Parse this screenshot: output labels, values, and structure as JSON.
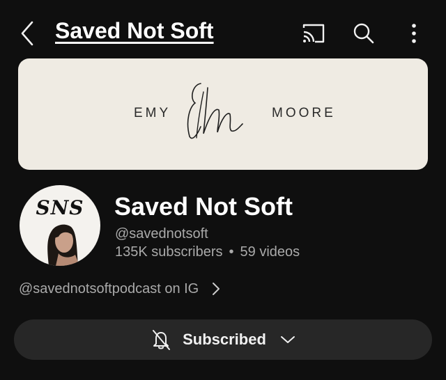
{
  "app_bar": {
    "title": "Saved Not Soft",
    "icons": {
      "back": "back-arrow-icon",
      "cast": "cast-icon",
      "search": "search-icon",
      "more": "more-vert-icon"
    }
  },
  "banner": {
    "left_text": "EMY",
    "right_text": "MOORE",
    "background": "#efebe3"
  },
  "channel": {
    "avatar_text": "SNS",
    "name": "Saved Not Soft",
    "handle": "@savednotsoft",
    "subscribers": "135K subscribers",
    "separator": "•",
    "videos": "59 videos",
    "link_text": "@savednotsoftpodcast on IG"
  },
  "subscribe_button": {
    "label": "Subscribed",
    "bell_icon": "notifications-off-icon",
    "dropdown_icon": "chevron-down-icon",
    "background": "#272727"
  },
  "colors": {
    "background": "#0f0f0f",
    "text_primary": "#ffffff",
    "text_secondary": "#aaaaaa"
  }
}
